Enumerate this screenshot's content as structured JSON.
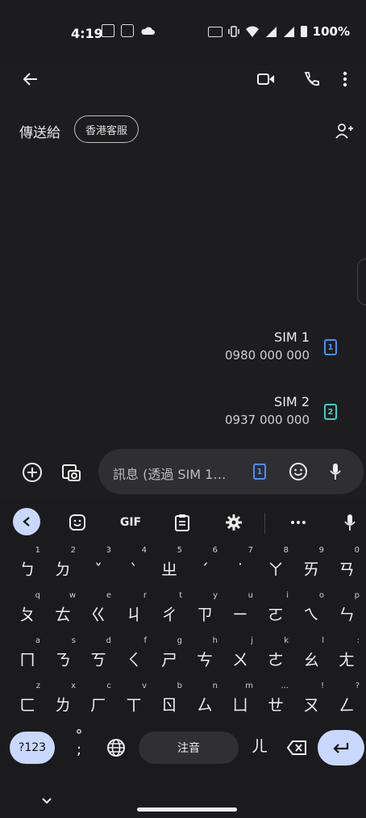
{
  "status": {
    "time": "4:19",
    "battery": "100%"
  },
  "recipients": {
    "label": "傳送給",
    "chip": "香港客服"
  },
  "sims": [
    {
      "title": "SIM 1",
      "number": "0980 000 000",
      "badge": "1",
      "color": "#4c8dff"
    },
    {
      "title": "SIM 2",
      "number": "0937 000 000",
      "badge": "2",
      "color": "#3fd0c8"
    }
  ],
  "compose": {
    "placeholder": "訊息 (透過 SIM 1…",
    "sim_badge": "1"
  },
  "keyboard": {
    "toolbar": {
      "gif": "GIF"
    },
    "row1": [
      {
        "hint": "1",
        "main": "ㄅ"
      },
      {
        "hint": "2",
        "main": "ㄉ"
      },
      {
        "hint": "3",
        "main": "ˇ"
      },
      {
        "hint": "4",
        "main": "ˋ"
      },
      {
        "hint": "5",
        "main": "ㄓ"
      },
      {
        "hint": "6",
        "main": "ˊ"
      },
      {
        "hint": "7",
        "main": "˙"
      },
      {
        "hint": "8",
        "main": "ㄚ"
      },
      {
        "hint": "9",
        "main": "ㄞ"
      },
      {
        "hint": "0",
        "main": "ㄢ"
      }
    ],
    "row2": [
      {
        "hint": "q",
        "main": "ㄆ"
      },
      {
        "hint": "w",
        "main": "ㄊ"
      },
      {
        "hint": "e",
        "main": "ㄍ"
      },
      {
        "hint": "r",
        "main": "ㄐ"
      },
      {
        "hint": "t",
        "main": "ㄔ"
      },
      {
        "hint": "y",
        "main": "ㄗ"
      },
      {
        "hint": "u",
        "main": "ㄧ"
      },
      {
        "hint": "i",
        "main": "ㄛ"
      },
      {
        "hint": "o",
        "main": "ㄟ"
      },
      {
        "hint": "p",
        "main": "ㄣ"
      }
    ],
    "row3": [
      {
        "hint": "a",
        "main": "ㄇ"
      },
      {
        "hint": "s",
        "main": "ㄋ"
      },
      {
        "hint": "d",
        "main": "ㄎ"
      },
      {
        "hint": "f",
        "main": "ㄑ"
      },
      {
        "hint": "g",
        "main": "ㄕ"
      },
      {
        "hint": "h",
        "main": "ㄘ"
      },
      {
        "hint": "j",
        "main": "ㄨ"
      },
      {
        "hint": "k",
        "main": "ㄜ"
      },
      {
        "hint": "l",
        "main": "ㄠ"
      },
      {
        "hint": ":",
        "main": "ㄤ"
      }
    ],
    "row4": [
      {
        "hint": "z",
        "main": "ㄈ"
      },
      {
        "hint": "x",
        "main": "ㄌ"
      },
      {
        "hint": "c",
        "main": "ㄏ"
      },
      {
        "hint": "v",
        "main": "ㄒ"
      },
      {
        "hint": "b",
        "main": "ㄖ"
      },
      {
        "hint": "n",
        "main": "ㄙ"
      },
      {
        "hint": "m",
        "main": "ㄩ"
      },
      {
        "hint": "...",
        "main": "ㄝ"
      },
      {
        "hint": "!",
        "main": "ㄡ"
      },
      {
        "hint": "?",
        "main": "ㄥ"
      }
    ],
    "symbols": "?123",
    "punct": "°\n;",
    "space": "注音",
    "er": "ㄦ"
  }
}
